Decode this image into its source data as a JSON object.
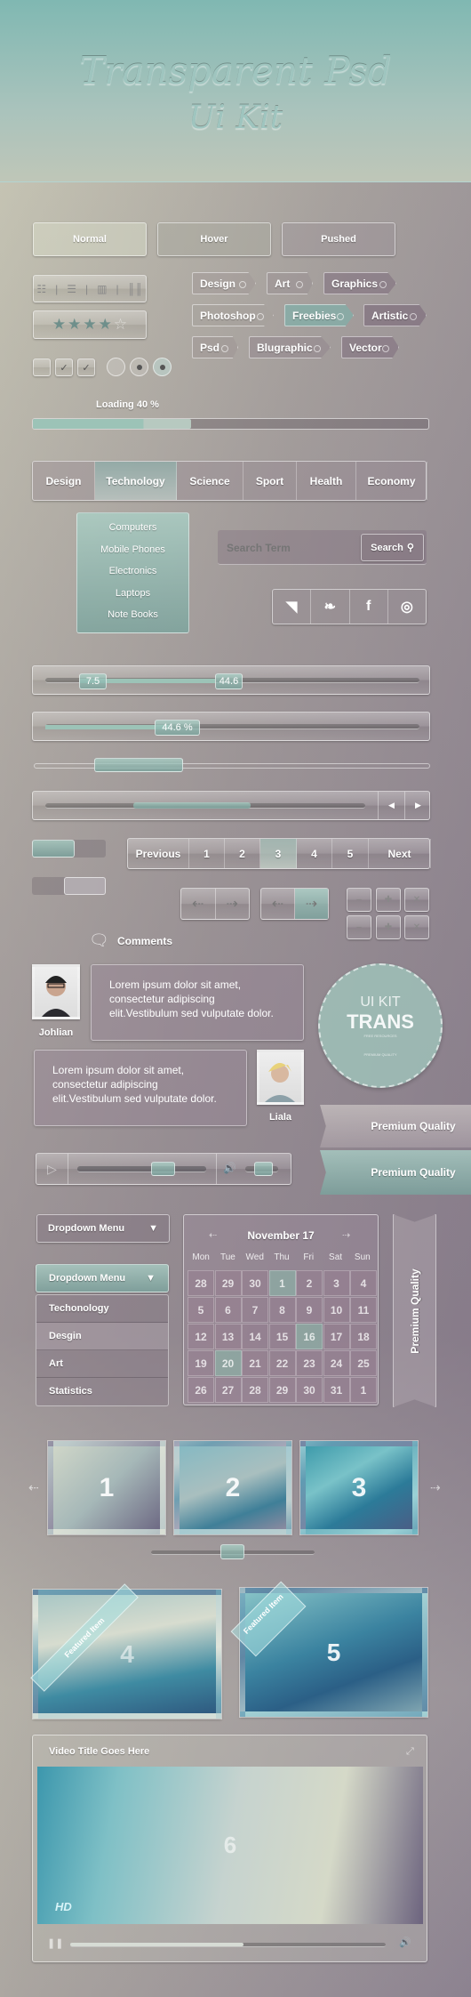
{
  "header": {
    "title_line1": "Transparent Psd",
    "title_line2": "Ui Kit"
  },
  "buttons": {
    "normal": "Normal",
    "hover": "Hover",
    "pushed": "Pushed"
  },
  "view_toggle": [
    "grid-view-icon",
    "list-view-icon",
    "column-view-icon",
    "barcode-view-icon"
  ],
  "rating": {
    "value": 4,
    "max": 5
  },
  "checkboxes": [
    {
      "checked": false
    },
    {
      "checked": true
    },
    {
      "checked": true
    }
  ],
  "radios": [
    {
      "selected": false
    },
    {
      "selected": true
    },
    {
      "selected": true
    }
  ],
  "tags": [
    [
      "Design",
      "Art",
      "Graphics"
    ],
    [
      "Photoshop",
      "Freebies",
      "Artistic"
    ],
    [
      "Psd",
      "Blugraphic",
      "Vector"
    ]
  ],
  "progress": {
    "label": "Loading 40 %",
    "value": 40
  },
  "nav": {
    "items": [
      "Design",
      "Technology",
      "Science",
      "Sport",
      "Health",
      "Economy"
    ],
    "active": "Technology",
    "submenu": [
      "Computers",
      "Mobile Phones",
      "Electronics",
      "Laptops",
      "Note Books"
    ]
  },
  "search": {
    "placeholder": "Search Term",
    "button": "Search"
  },
  "social": [
    "rss-icon",
    "twitter-icon",
    "facebook-icon",
    "dribbble-icon"
  ],
  "range_slider": {
    "low": "7.5",
    "high": "44.6"
  },
  "percent_slider": {
    "label": "44.6 %",
    "value": 44.6
  },
  "pagination": {
    "prev": "Previous",
    "pages": [
      "1",
      "2",
      "3",
      "4",
      "5"
    ],
    "active": "3",
    "next": "Next"
  },
  "comments": {
    "heading": "Comments",
    "items": [
      {
        "author": "Johlian",
        "text": "Lorem ipsum dolor sit amet, consectetur adipiscing elit.Vestibulum sed vulputate dolor."
      },
      {
        "author": "Liala",
        "text": "Lorem ipsum dolor sit amet, consectetur adipiscing elit.Vestibulum sed vulputate dolor."
      }
    ]
  },
  "badge": {
    "line1": "UI KIT",
    "line2": "TRANS",
    "line3": "FREE RESOURCES",
    "line4": "PREMIUM QUALITY"
  },
  "ribbons": [
    "Premium Quality",
    "Premium Quality"
  ],
  "vertical_ribbon": "Premium Quality",
  "dropdown": {
    "label": "Dropdown Menu",
    "open_label": "Dropdown Menu",
    "items": [
      "Techonology",
      "Desgin",
      "Art",
      "Statistics"
    ]
  },
  "calendar": {
    "title": "November 17",
    "days": [
      "Mon",
      "Tue",
      "Wed",
      "Thu",
      "Fri",
      "Sat",
      "Sun"
    ],
    "dates": [
      "28",
      "29",
      "30",
      "1",
      "2",
      "3",
      "4",
      "5",
      "6",
      "7",
      "8",
      "9",
      "10",
      "11",
      "12",
      "13",
      "14",
      "15",
      "16",
      "17",
      "18",
      "19",
      "20",
      "21",
      "22",
      "23",
      "24",
      "25",
      "26",
      "27",
      "28",
      "29",
      "30",
      "31",
      "1"
    ],
    "highlighted": [
      3,
      18,
      22
    ]
  },
  "gallery": [
    "1",
    "2",
    "3"
  ],
  "featured": [
    {
      "number": "4",
      "ribbon": "Featured Item"
    },
    {
      "number": "5",
      "ribbon": "Featured Item"
    }
  ],
  "video": {
    "title": "Video Title Goes Here",
    "number": "6",
    "badge": "HD",
    "progress": 55
  },
  "colors": {
    "accent_teal": "#8fbcb3",
    "header_teal": "#80b8b2"
  }
}
